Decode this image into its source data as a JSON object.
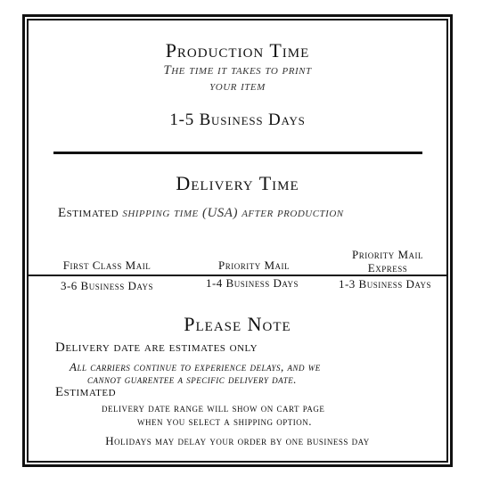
{
  "production": {
    "title": "Production Time",
    "subtitle_line1": "The time it takes to print",
    "subtitle_line2": "your item",
    "value": "1-5 Business Days"
  },
  "delivery": {
    "title": "Delivery Time",
    "estimated_label": "Estimated",
    "estimated_italic": "shipping time (USA) after production",
    "options": [
      {
        "name": "First Class Mail",
        "time": "3-6 Business Days"
      },
      {
        "name": "Priority Mail",
        "time": "1-4 Business Days"
      },
      {
        "name_line1": "Priority Mail",
        "name_line2": "Express",
        "time": "1-3 Business Days"
      }
    ]
  },
  "note": {
    "title": "Please Note",
    "line1": "Delivery date are estimates only",
    "italic_line1": "All carriers continue to experience delays, and we",
    "italic_line2": "cannot guarentee a specific delivery date.",
    "estimated_label": "Estimated",
    "range_line1": "delivery date range will show on cart page",
    "range_line2": "when you select a shipping option.",
    "holidays": "Holidays may delay your order by one business day"
  }
}
